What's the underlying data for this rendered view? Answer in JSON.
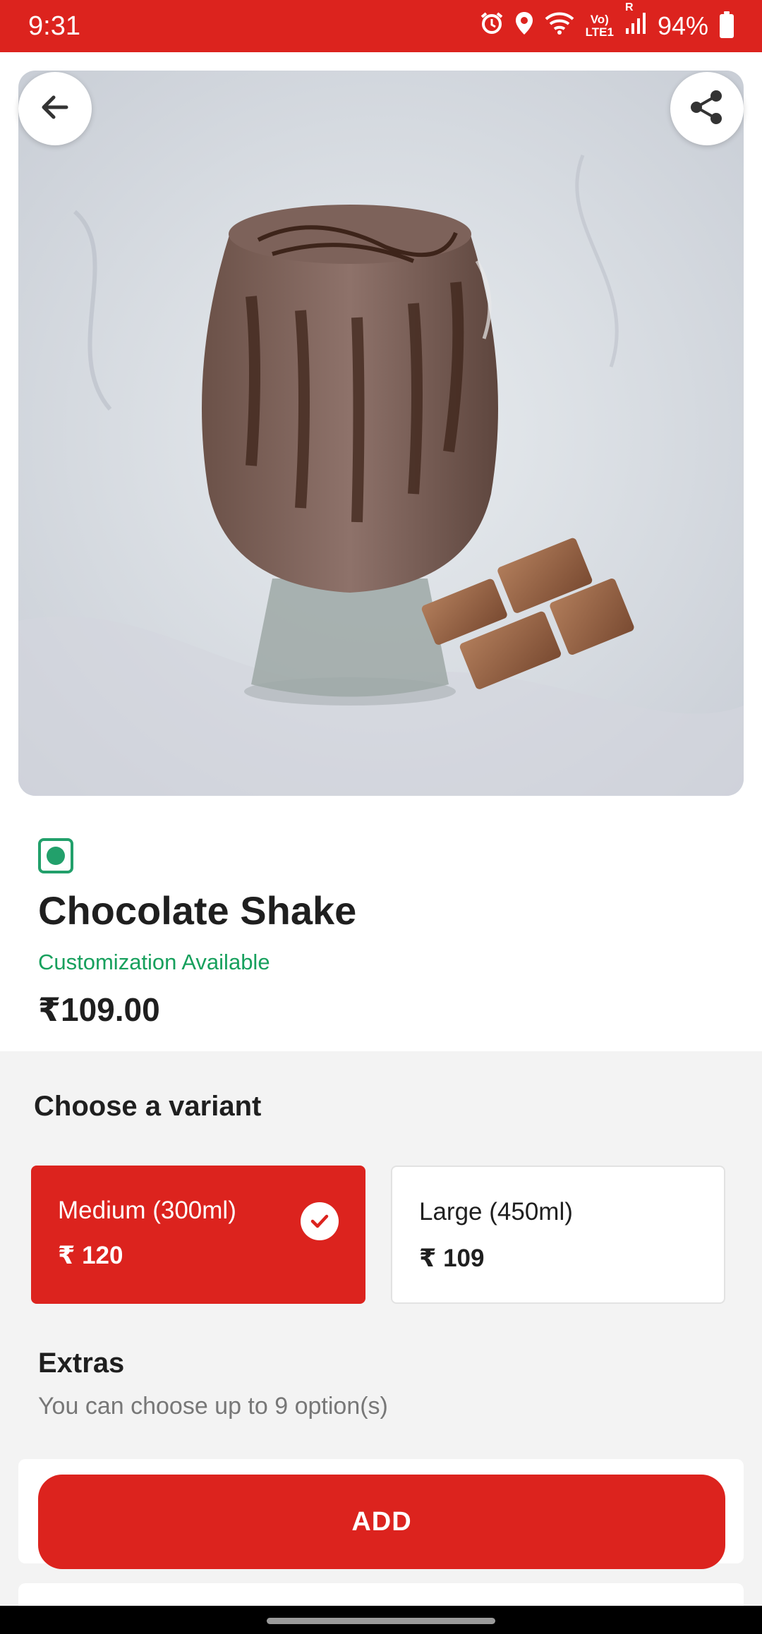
{
  "status_bar": {
    "time": "9:31",
    "network_top": "Vo)",
    "network_bottom": "LTE1",
    "roaming": "R",
    "battery": "94%",
    "icons": [
      "alarm-icon",
      "location-icon",
      "wifi-icon",
      "signal-icon",
      "battery-icon"
    ]
  },
  "colors": {
    "brand_red": "#dc231e",
    "veg_green": "#22a06b",
    "customization_green": "#17a05d"
  },
  "header_buttons": {
    "back_icon": "arrow-left-icon",
    "share_icon": "share-icon"
  },
  "product": {
    "image": "chocolate-shake-photo",
    "veg_indicator": "veg-icon",
    "name": "Chocolate Shake",
    "customization_text": "Customization Available",
    "price": "₹109.00"
  },
  "variants": {
    "heading": "Choose a variant",
    "options": [
      {
        "name": "Medium (300ml)",
        "price": "₹ 120",
        "selected": true
      },
      {
        "name": "Large (450ml)",
        "price": "₹ 109",
        "selected": false
      }
    ]
  },
  "extras": {
    "title": "Extras",
    "subtitle": "You can choose up to 9 option(s)"
  },
  "cta": {
    "add_label": "ADD"
  }
}
